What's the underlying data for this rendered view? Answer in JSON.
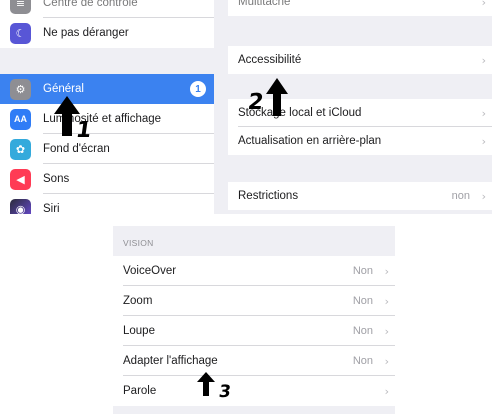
{
  "sidebar": {
    "items": [
      {
        "label": "Centre de contrôle",
        "icon": "control-center-icon",
        "color": "#8e8e93"
      },
      {
        "label": "Ne pas déranger",
        "icon": "moon-icon",
        "color": "#5856d6"
      },
      {
        "label": "Général",
        "icon": "gear-icon",
        "color": "#8e8e93",
        "badge": "1",
        "selected": true
      },
      {
        "label": "Luminosité et affichage",
        "icon": "display-brightness-icon",
        "color": "#2f7cf6"
      },
      {
        "label": "Fond d'écran",
        "icon": "wallpaper-icon",
        "color": "#34aadc"
      },
      {
        "label": "Sons",
        "icon": "speaker-icon",
        "color": "#ff3b55"
      },
      {
        "label": "Siri",
        "icon": "siri-icon",
        "color": "#2b2b3a"
      }
    ]
  },
  "general_detail": {
    "top_row": "Multitâche",
    "accessibility": "Accessibilité",
    "storage": "Stockage local et iCloud",
    "background_refresh": "Actualisation en arrière-plan",
    "restrictions": "Restrictions",
    "restrictions_value": "non"
  },
  "vision": {
    "header": "VISION",
    "rows": [
      {
        "label": "VoiceOver",
        "value": "Non"
      },
      {
        "label": "Zoom",
        "value": "Non"
      },
      {
        "label": "Loupe",
        "value": "Non"
      },
      {
        "label": "Adapter l'affichage",
        "value": "Non"
      },
      {
        "label": "Parole",
        "value": ""
      }
    ]
  },
  "annotations": {
    "step1": "1",
    "step2": "2",
    "step3": "3"
  },
  "colors": {
    "accent": "#3b82f0",
    "background": "#efeff4"
  }
}
